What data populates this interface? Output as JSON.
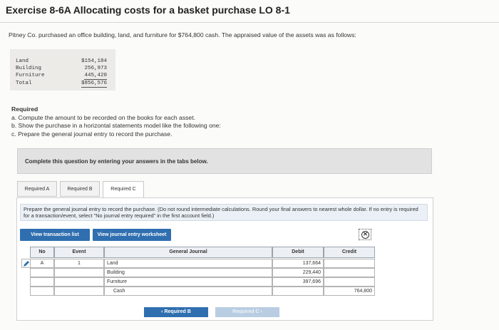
{
  "title": "Exercise 8-6A Allocating costs for a basket purchase LO 8-1",
  "intro": "Pitney Co. purchased an office building, land, and furniture for $764,800 cash. The appraised value of the assets was as follows:",
  "assets": [
    {
      "label": "Land",
      "value": "$154,184"
    },
    {
      "label": "Building",
      "value": "256,973"
    },
    {
      "label": "Furniture",
      "value": "445,420"
    },
    {
      "label": "Total",
      "value": "$856,576"
    }
  ],
  "required": {
    "heading": "Required",
    "a": "a. Compute the amount to be recorded on the books for each asset.",
    "b": "b. Show the purchase in a horizontal statements model like the following one:",
    "c": "c. Prepare the general journal entry to record the purchase."
  },
  "instruction_bar": "Complete this question by entering your answers in the tabs below.",
  "tabs": [
    {
      "label": "Required A",
      "active": false
    },
    {
      "label": "Required B",
      "active": false
    },
    {
      "label": "Required C",
      "active": true
    }
  ],
  "panel_instruction": "Prepare the general journal entry to record the purchase. (Do not round intermediate calculations. Round your final answers to nearest whole dollar. If no entry is required for a transaction/event, select \"No journal entry required\" in the first account field.)",
  "buttons": {
    "view_transaction_list": "View transaction list",
    "view_journal_worksheet": "View journal entry worksheet",
    "clear_symbol": "✕"
  },
  "journal": {
    "headers": {
      "no": "No",
      "event": "Event",
      "account": "General Journal",
      "debit": "Debit",
      "credit": "Credit"
    },
    "rows": [
      {
        "no": "A",
        "event": "1",
        "account": "Land",
        "debit": "137,664",
        "credit": ""
      },
      {
        "no": "",
        "event": "",
        "account": "Building",
        "debit": "229,440",
        "credit": ""
      },
      {
        "no": "",
        "event": "",
        "account": "Furniture",
        "debit": "397,696",
        "credit": ""
      },
      {
        "no": "",
        "event": "",
        "account": "Cash",
        "debit": "",
        "credit": "764,800"
      }
    ]
  },
  "nav": {
    "prev": "Required B",
    "next": "Required C"
  },
  "colors": {
    "accent": "#2f6fb0",
    "panel_bg": "#eaf0f6"
  }
}
